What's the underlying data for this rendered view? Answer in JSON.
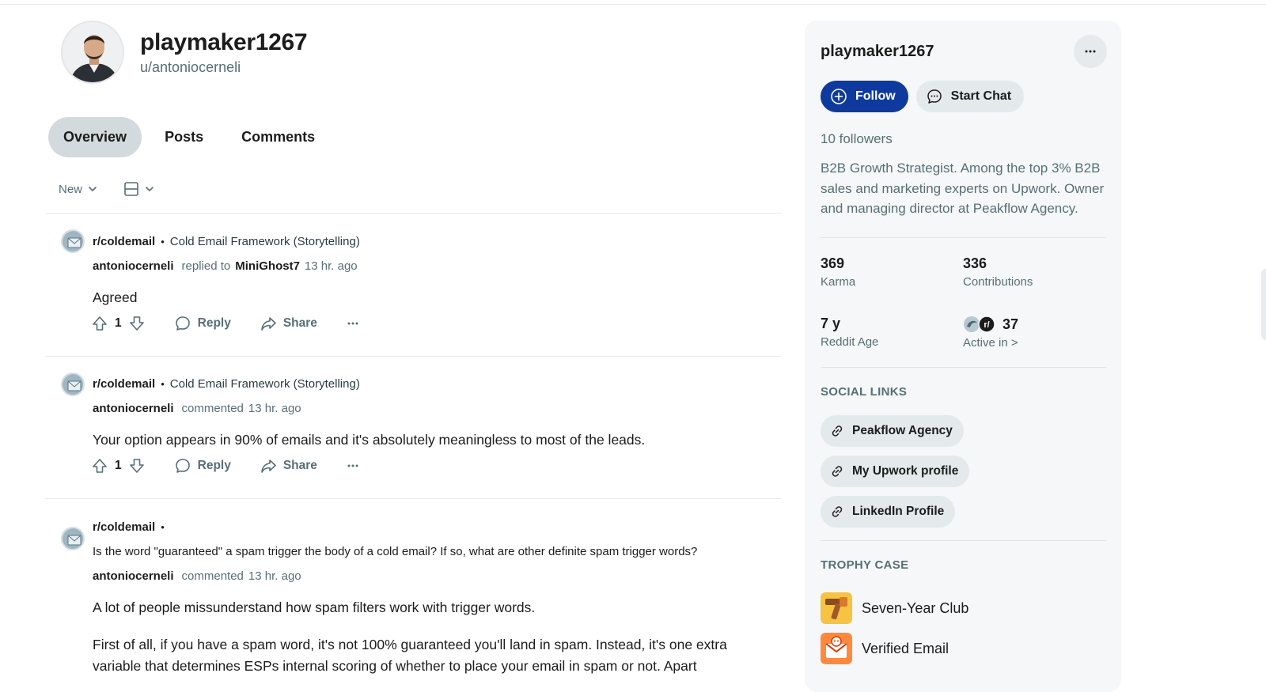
{
  "profile": {
    "display_name": "playmaker1267",
    "username": "u/antoniocerneli"
  },
  "tabs": [
    {
      "label": "Overview",
      "active": true
    },
    {
      "label": "Posts",
      "active": false
    },
    {
      "label": "Comments",
      "active": false
    }
  ],
  "sort": {
    "label": "New"
  },
  "feed": [
    {
      "subreddit": "r/coldemail",
      "post_title": "Cold Email Framework (Storytelling)",
      "author": "antoniocerneli",
      "action": "replied to",
      "target": "MiniGhost7",
      "time": "13 hr. ago",
      "body": "Agreed",
      "votes": "1",
      "reply_label": "Reply",
      "share_label": "Share"
    },
    {
      "subreddit": "r/coldemail",
      "post_title": "Cold Email Framework (Storytelling)",
      "author": "antoniocerneli",
      "action": "commented",
      "time": "13 hr. ago",
      "body": "Your option appears in 90% of emails and it's absolutely meaningless to most of the leads.",
      "votes": "1",
      "reply_label": "Reply",
      "share_label": "Share"
    },
    {
      "subreddit": "r/coldemail",
      "post_title": "Is the word \"guaranteed\" a spam trigger the body of a cold email? If so, what are other definite spam trigger words?",
      "author": "antoniocerneli",
      "action": "commented",
      "time": "13 hr. ago",
      "body_p1": "A lot of people missunderstand how spam filters work with trigger words.",
      "body_p2": "First of all, if you have a spam word, it's not 100% guaranteed you'll land in spam. Instead, it's one extra variable that determines ESPs internal scoring of whether to place your email in spam or not. Apart"
    }
  ],
  "sidebar": {
    "title": "playmaker1267",
    "follow_label": "Follow",
    "chat_label": "Start Chat",
    "followers": "10 followers",
    "bio": "B2B Growth Strategist. Among the top 3% B2B sales and marketing experts on Upwork. Owner and managing director at Peakflow Agency.",
    "stats": {
      "karma_value": "369",
      "karma_label": "Karma",
      "contrib_value": "336",
      "contrib_label": "Contributions",
      "age_value": "7 y",
      "age_label": "Reddit Age",
      "active_value": "37",
      "active_label": "Active in >"
    },
    "social_heading": "SOCIAL LINKS",
    "social_links": [
      "Peakflow Agency",
      "My Upwork profile",
      "LinkedIn Profile"
    ],
    "trophy_heading": "TROPHY CASE",
    "trophies": [
      "Seven-Year Club",
      "Verified Email"
    ]
  },
  "colors": {
    "follow_button": "#0d3a9c",
    "tab_active_bg": "#d2dadd",
    "muted_text": "#576f76",
    "card_bg": "#f5f7f8"
  },
  "icons": [
    "upvote-icon",
    "downvote-icon",
    "comment-icon",
    "share-icon",
    "more-icon",
    "chevron-down-icon",
    "card-view-icon",
    "plus-circle-icon",
    "chat-bubble-icon",
    "link-icon"
  ]
}
